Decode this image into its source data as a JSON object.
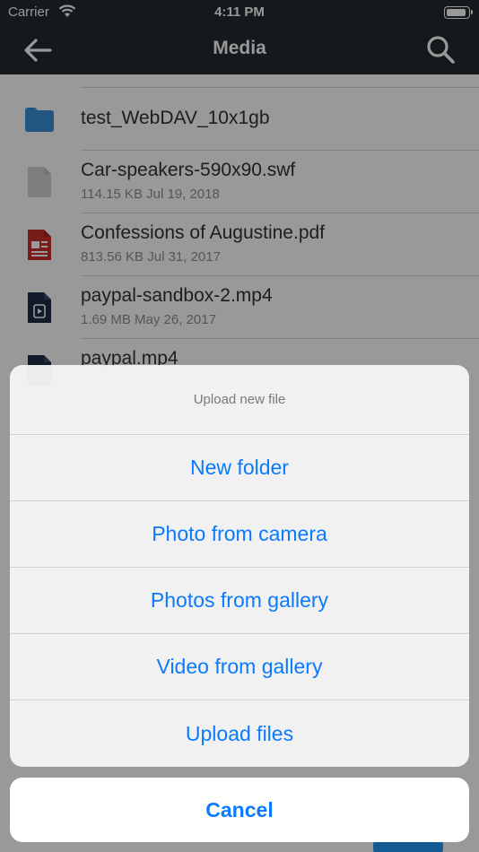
{
  "status_bar": {
    "carrier": "Carrier",
    "time": "4:11 PM",
    "battery_level": 1.0
  },
  "nav": {
    "title": "Media",
    "back_icon": "arrow-left-icon",
    "search_icon": "search-icon"
  },
  "files": [
    {
      "name": "test_WebDAV_10x1gb",
      "meta": "",
      "icon": "folder-icon",
      "color": "#3a8fd6"
    },
    {
      "name": "Car-speakers-590x90.swf",
      "meta": "114.15 KB Jul 19, 2018",
      "icon": "generic-file-icon",
      "color": "#d3d3d3"
    },
    {
      "name": "Confessions of Augustine.pdf",
      "meta": "813.56 KB Jul 31, 2017",
      "icon": "pdf-file-icon",
      "color": "#c9302c"
    },
    {
      "name": "paypal-sandbox-2.mp4",
      "meta": "1.69 MB May 26, 2017",
      "icon": "mp4-file-icon",
      "color": "#1f2a44"
    },
    {
      "name": "paypal.mp4",
      "meta": "",
      "icon": "mp4-file-icon",
      "color": "#1f2a44"
    }
  ],
  "action_sheet": {
    "title": "Upload new file",
    "actions": [
      "New folder",
      "Photo from camera",
      "Photos from gallery",
      "Video from gallery",
      "Upload files"
    ],
    "cancel": "Cancel"
  },
  "colors": {
    "nav_bg": "#222a30",
    "accent": "#0a7aff",
    "fab": "#2196f3"
  }
}
